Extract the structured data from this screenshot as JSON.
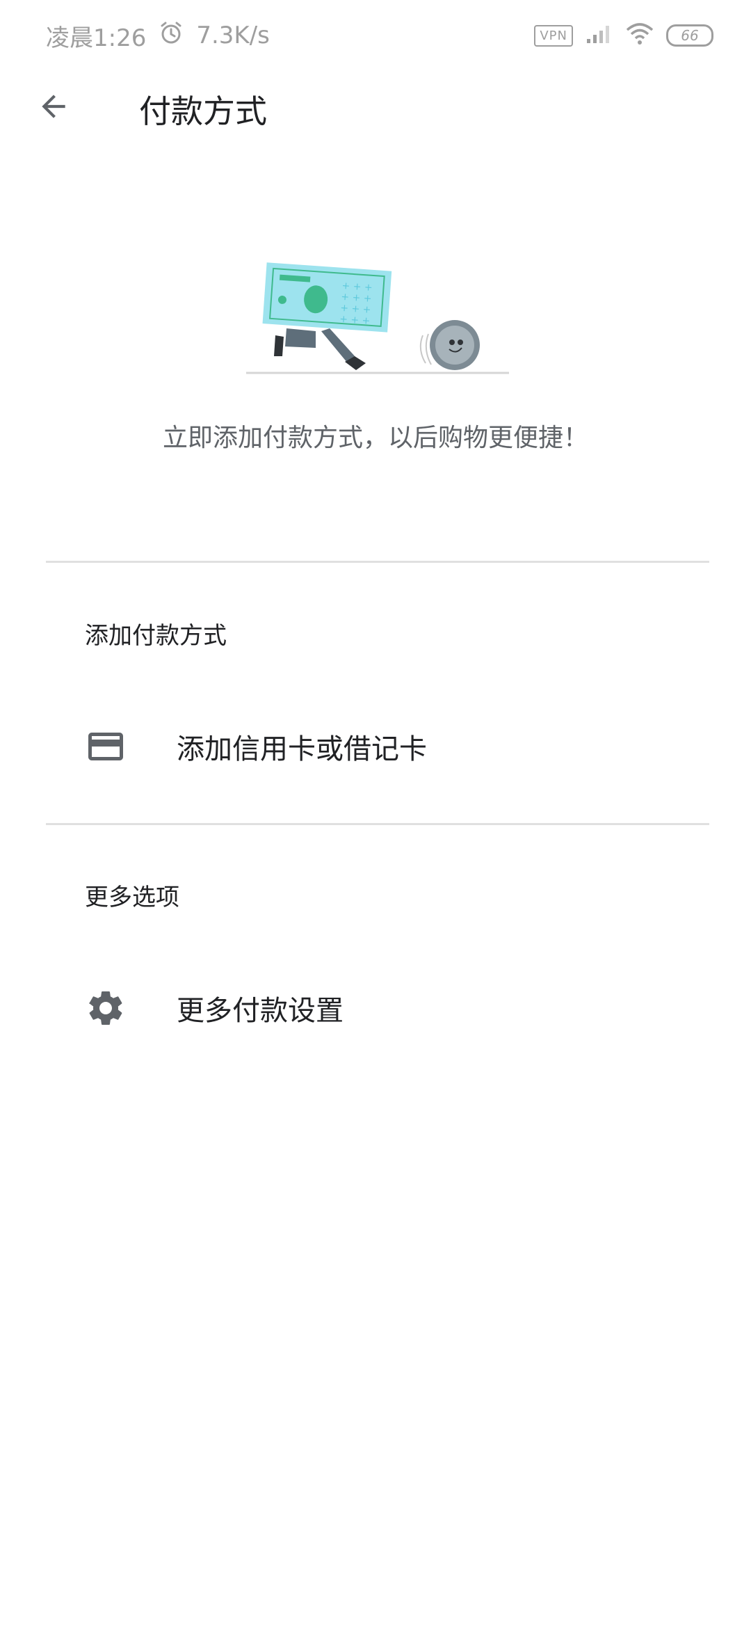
{
  "status_bar": {
    "time": "凌晨1:26",
    "net_speed": "7.3K/s",
    "vpn": "VPN",
    "battery": "66",
    "icons": [
      "alarm-icon",
      "signal-icon",
      "wifi-icon",
      "battery-icon"
    ]
  },
  "app_bar": {
    "back_icon": "arrow-back-icon",
    "title": "付款方式"
  },
  "empty_state": {
    "illustration": "running-banknote-and-coin",
    "message": "立即添加付款方式，以后购物更便捷！"
  },
  "sections": [
    {
      "header": "添加付款方式",
      "items": [
        {
          "icon": "credit-card-icon",
          "label": "添加信用卡或借记卡"
        }
      ]
    },
    {
      "header": "更多选项",
      "items": [
        {
          "icon": "gear-icon",
          "label": "更多付款设置"
        }
      ]
    }
  ],
  "colors": {
    "text_primary": "#202124",
    "text_secondary": "#5f6368",
    "icon": "#5f6368",
    "divider": "#e0e0e0",
    "illustration_bill": "#9de3ee",
    "illustration_accent": "#3fba8d"
  }
}
